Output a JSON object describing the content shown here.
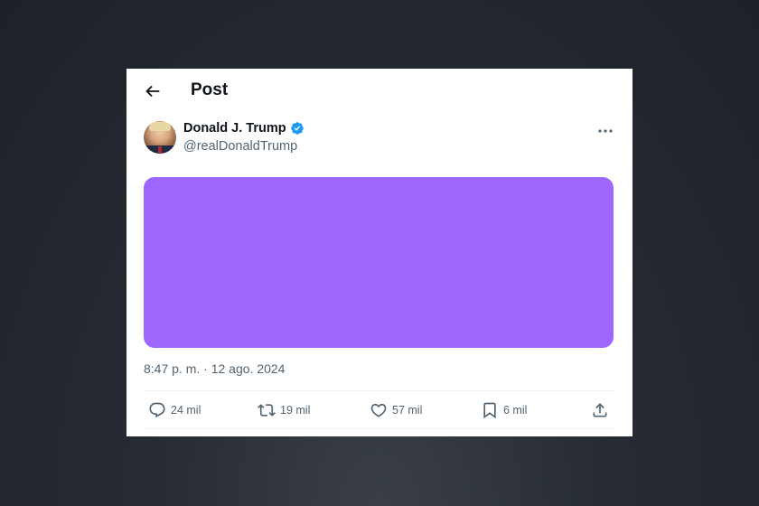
{
  "header": {
    "title": "Post"
  },
  "author": {
    "name": "Donald J. Trump",
    "handle": "@realDonaldTrump",
    "verified": true,
    "verified_color": "#1d9bf0"
  },
  "media": {
    "color": "#9d67fd"
  },
  "timestamp": "8:47 p. m. · 12 ago. 2024",
  "actions": {
    "replies": "24 mil",
    "reposts": "19 mil",
    "likes": "57 mil",
    "bookmarks": "6 mil"
  },
  "icons": [
    "back-arrow-icon",
    "verified-badge-icon",
    "more-options-icon",
    "reply-icon",
    "repost-icon",
    "like-icon",
    "bookmark-icon",
    "share-icon"
  ]
}
